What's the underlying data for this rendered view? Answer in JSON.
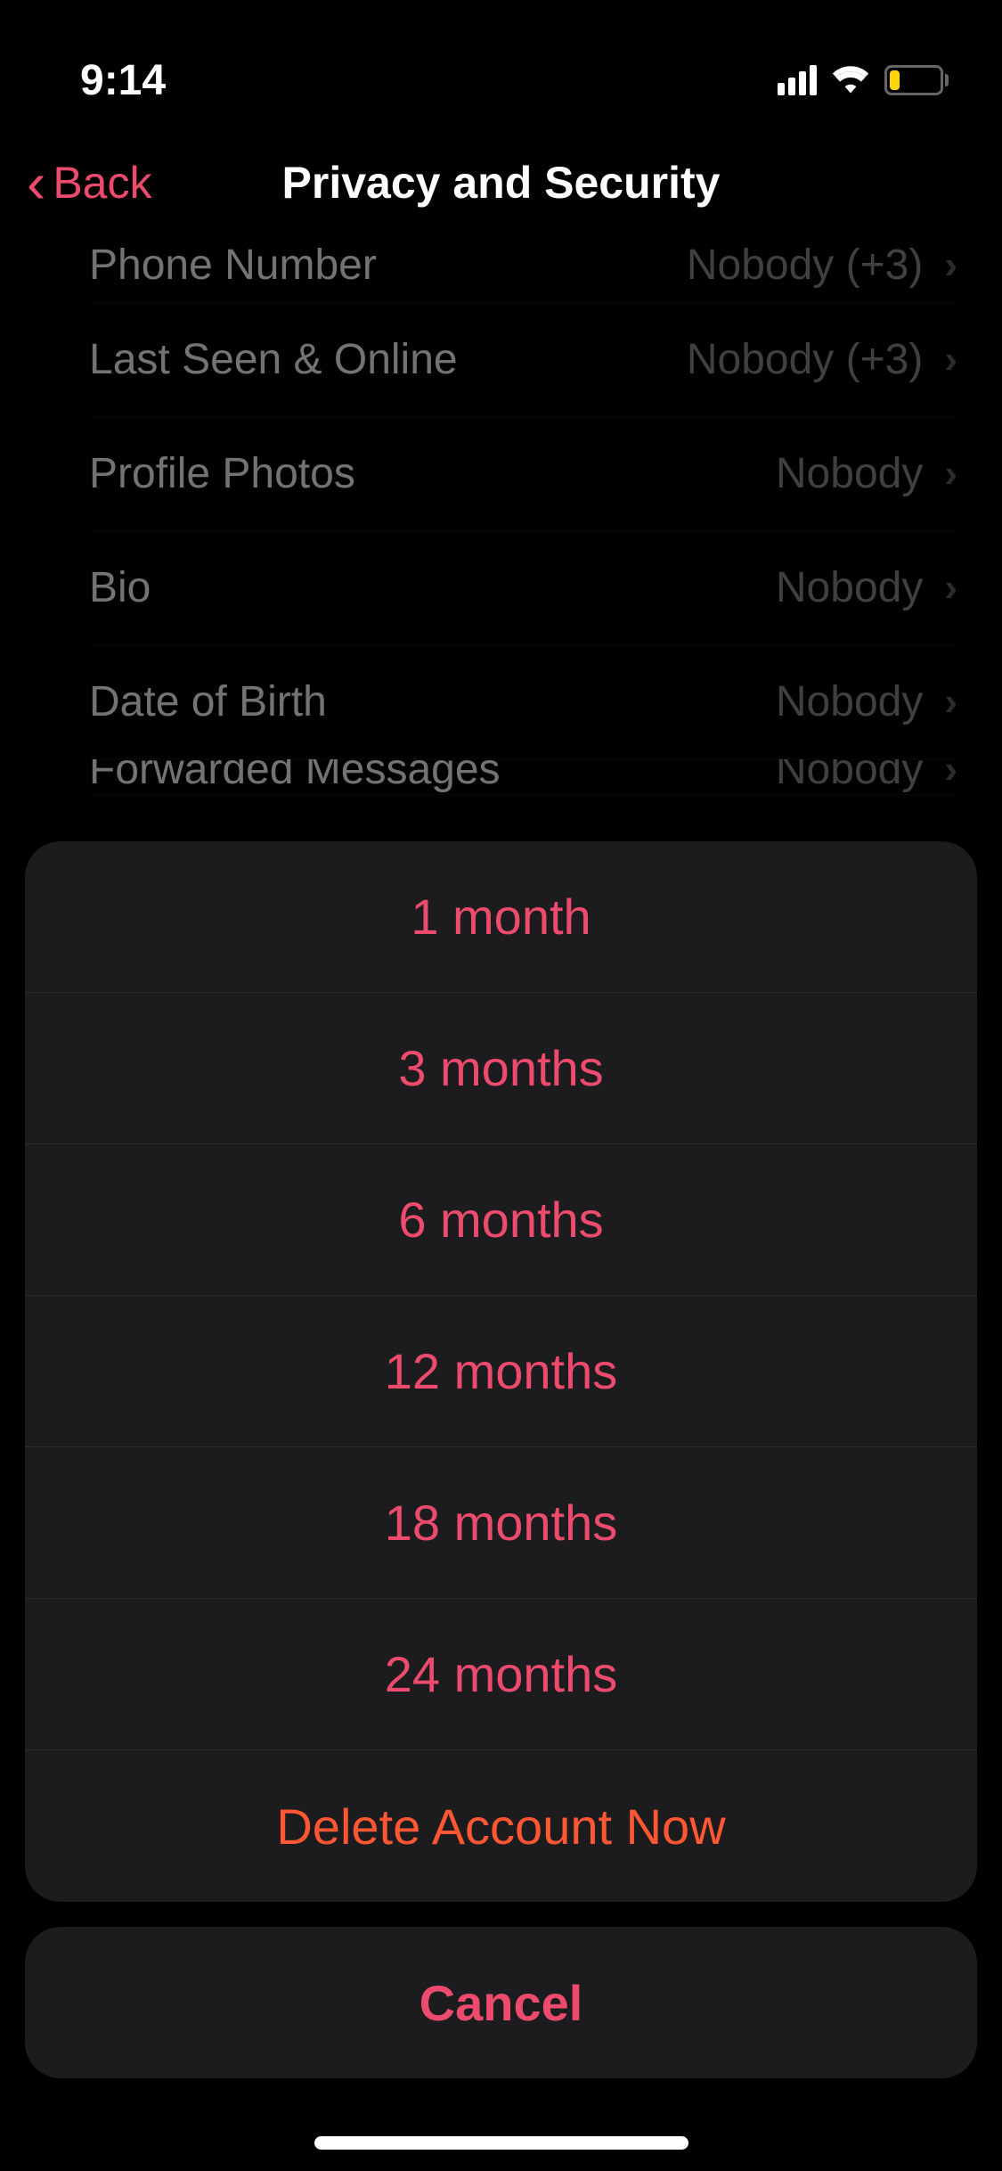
{
  "status": {
    "time": "9:14",
    "battery_level": "20"
  },
  "nav": {
    "back_label": "Back",
    "title": "Privacy and Security"
  },
  "list": {
    "rows": [
      {
        "label": "Phone Number",
        "value": "Nobody (+3)"
      },
      {
        "label": "Last Seen & Online",
        "value": "Nobody (+3)"
      },
      {
        "label": "Profile Photos",
        "value": "Nobody"
      },
      {
        "label": "Bio",
        "value": "Nobody"
      },
      {
        "label": "Date of Birth",
        "value": "Nobody"
      },
      {
        "label": "Forwarded Messages",
        "value": "Nobody"
      }
    ]
  },
  "action_sheet": {
    "options": [
      "1 month",
      "3 months",
      "6 months",
      "12 months",
      "18 months",
      "24 months"
    ],
    "destructive": "Delete Account Now",
    "cancel": "Cancel"
  }
}
